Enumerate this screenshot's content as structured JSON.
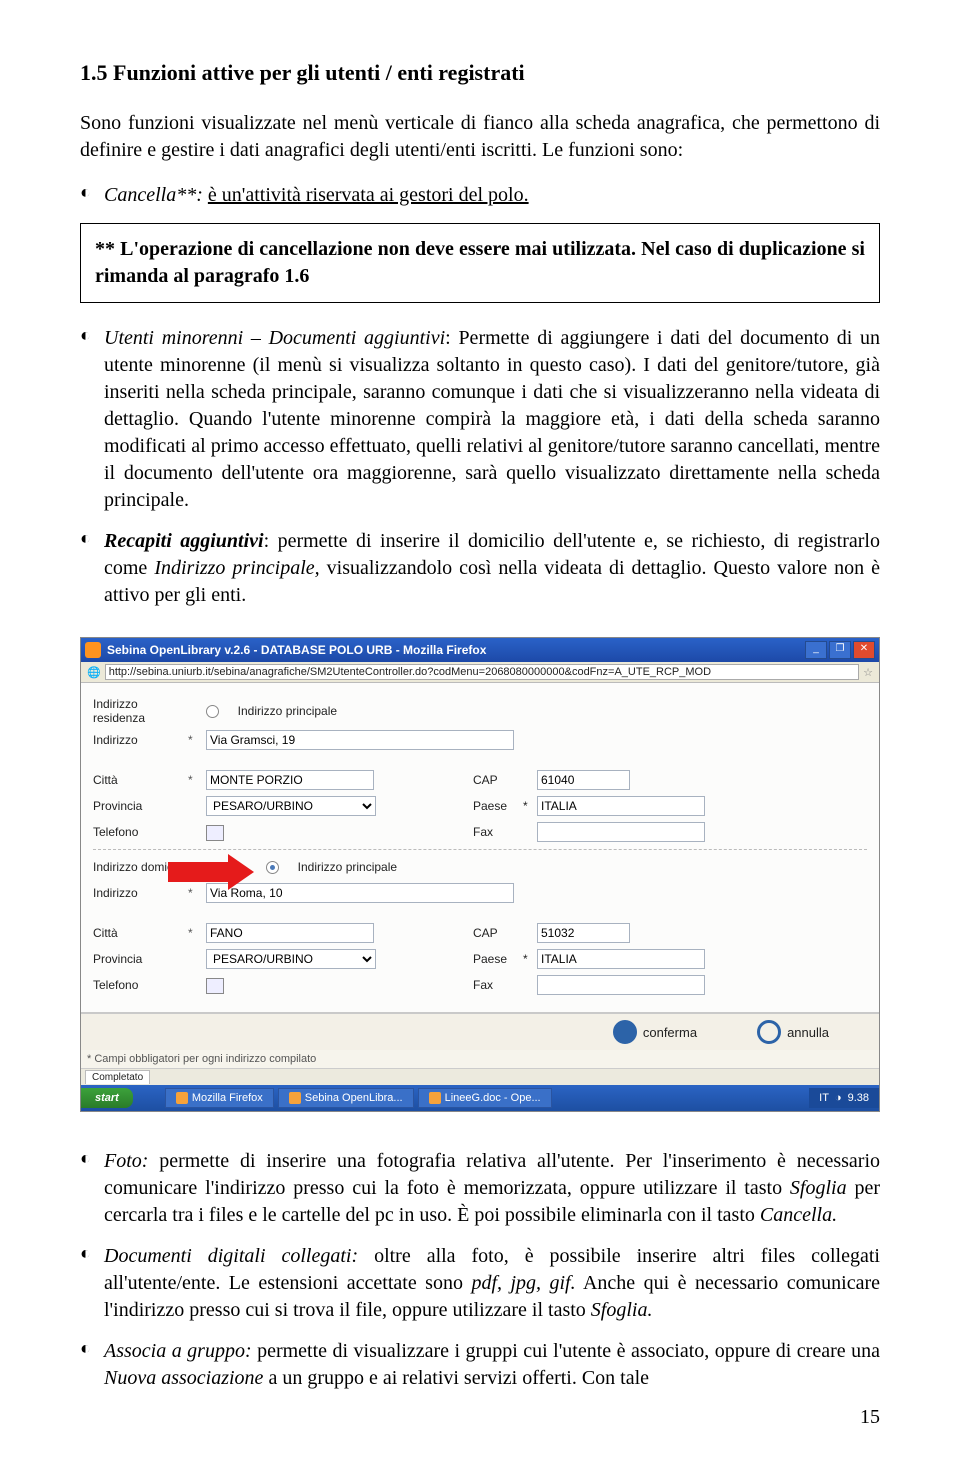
{
  "heading": "1.5 Funzioni attive per gli utenti / enti registrati",
  "intro": "Sono funzioni visualizzate nel menù verticale di fianco alla scheda anagrafica, che permettono di definire e gestire i dati anagrafici degli utenti/enti iscritti. Le funzioni sono:",
  "bullet_cancel_prefix": "Cancella**: ",
  "bullet_cancel_rest": "è un'attività riservata ai gestori del polo.",
  "box": "** L'operazione di cancellazione non deve essere mai utilizzata. Nel caso di duplicazione si rimanda al paragrafo 1.6",
  "bullet_minor_title": "Utenti minorenni – Documenti aggiuntivi",
  "bullet_minor_body": ": Permette di aggiungere i dati del documento di un utente minorenne (il menù si visualizza soltanto in questo caso). I dati del genitore/tutore, già inseriti nella scheda principale, saranno comunque i dati che si visualizzeranno nella videata di dettaglio. Quando l'utente minorenne compirà la maggiore età, i dati della scheda saranno modificati al primo accesso effettuato, quelli relativi al genitore/tutore saranno cancellati, mentre il documento dell'utente ora maggiorenne, sarà quello visualizzato direttamente nella scheda principale.",
  "bullet_recapiti_title": "Recapiti aggiuntivi",
  "bullet_recapiti_body": ": permette di inserire il domicilio dell'utente e, se richiesto, di registrarlo come ",
  "bullet_recapiti_ital": "Indirizzo principale,",
  "bullet_recapiti_body2": " visualizzandolo così nella videata di dettaglio. Questo valore non è attivo per gli enti.",
  "screenshot": {
    "title": "Sebina OpenLibrary v.2.6 - DATABASE POLO URB - Mozilla Firefox",
    "url": "http://sebina.uniurb.it/sebina/anagrafiche/SM2UtenteController.do?codMenu=2068080000000&codFnz=A_UTE_RCP_MOD",
    "residenza_lbl": "Indirizzo residenza",
    "indir_lbl": "Indirizzo",
    "principale_lbl": "Indirizzo principale",
    "addr1": "Via Gramsci, 19",
    "citta_lbl": "Città",
    "citta1": "MONTE PORZIO",
    "cap_lbl": "CAP",
    "cap1": "61040",
    "prov_lbl": "Provincia",
    "prov": "PESARO/URBINO",
    "paese_lbl": "Paese",
    "paese": "ITALIA",
    "tele_lbl": "Telefono",
    "fax_lbl": "Fax",
    "domicilio_lbl": "Indirizzo domicilio",
    "addr2": "Via Roma, 10",
    "citta2": "FANO",
    "cap2": "51032",
    "conferma": "conferma",
    "annulla": "annulla",
    "note": "* Campi obbligatori per ogni indirizzo compilato",
    "tab": "Completato",
    "start": "start",
    "task1": "Mozilla Firefox",
    "task2": "Sebina OpenLibra...",
    "task3": "LineeG.doc - Ope...",
    "tray_lang": "IT",
    "tray_time": "9.38"
  },
  "bullet_foto_title": "Foto:",
  "bullet_foto_body": " permette di inserire una fotografia relativa all'utente. Per l'inserimento è necessario comunicare l'indirizzo presso cui la foto è memorizzata, oppure utilizzare il tasto ",
  "bullet_foto_ital1": "Sfoglia",
  "bullet_foto_body2": " per cercarla tra i files e le cartelle del pc in uso. È poi possibile eliminarla con il tasto ",
  "bullet_foto_ital2": "Cancella.",
  "bullet_doc_title": "Documenti digitali collegati:",
  "bullet_doc_body": " oltre alla foto, è possibile inserire altri files collegati all'utente/ente. Le estensioni accettate sono ",
  "bullet_doc_ital": "pdf, jpg, gif.",
  "bullet_doc_body2": " Anche qui è necessario comunicare l'indirizzo presso cui si trova il file, oppure utilizzare il tasto ",
  "bullet_doc_ital2": "Sfoglia.",
  "bullet_assoc_title": "Associa a gruppo:",
  "bullet_assoc_body": " permette di visualizzare i gruppi cui l'utente è associato, oppure di creare una ",
  "bullet_assoc_ital": "Nuova associazione",
  "bullet_assoc_body2": " a un  gruppo e ai relativi servizi offerti. Con tale",
  "page_num": "15"
}
